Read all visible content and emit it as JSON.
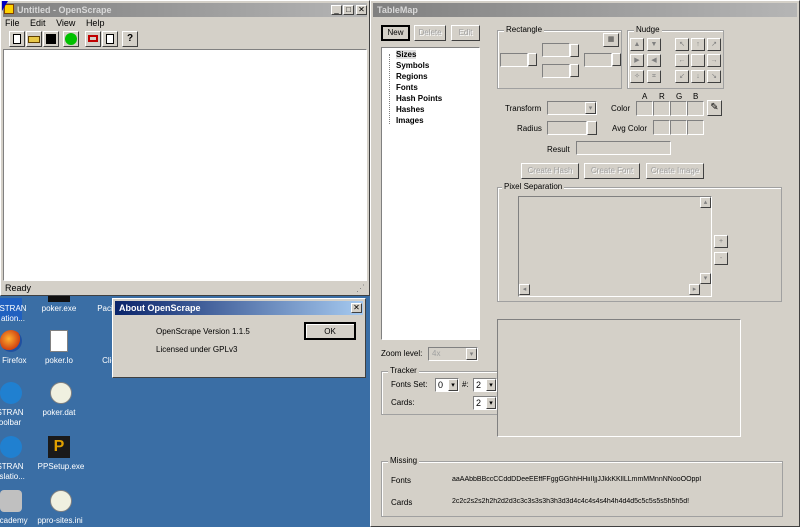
{
  "openscrape": {
    "title": "Untitled - OpenScrape",
    "menu": [
      "File",
      "Edit",
      "View",
      "Help"
    ],
    "status": "Ready"
  },
  "about": {
    "title": "About OpenScrape",
    "version": "OpenScrape Version 1.1.5",
    "license": "Licensed under GPLv3",
    "ok": "OK"
  },
  "tablemap": {
    "title": "TableMap",
    "buttons": {
      "new": "New",
      "delete": "Delete",
      "edit": "Edit"
    },
    "tree": [
      "Sizes",
      "Symbols",
      "Regions",
      "Fonts",
      "Hash Points",
      "Hashes",
      "Images"
    ],
    "rectangle_label": "Rectangle",
    "nudge_label": "Nudge",
    "transform_label": "Transform",
    "radius_label": "Radius",
    "color_label": "Color",
    "avg_color_label": "Avg Color",
    "result_label": "Result",
    "color_channels": [
      "A",
      "R",
      "G",
      "B"
    ],
    "create_hash": "Create Hash",
    "create_font": "Create Font",
    "create_image": "Create Image",
    "pixel_sep_label": "Pixel Separation",
    "zoom_label": "Zoom level:",
    "zoom_value": "4x",
    "tracker_label": "Tracker",
    "fonts_set_label": "Fonts Set:",
    "fonts_set_value": "0",
    "hash_label": "#:",
    "hash_value": "2",
    "cards_label": "Cards:",
    "cards_value": "2",
    "missing_label": "Missing",
    "missing_fonts_label": "Fonts",
    "missing_fonts_value": "aaAAbbBBccCCddDDeeEEffFFggGGhhHHiiIIjjJJkkKKllLLmmMMnnNNooOOppI",
    "missing_cards_label": "Cards",
    "missing_cards_value": "2c2c2s2s2h2h2d2d3c3c3s3s3h3h3d3d4c4c4s4s4h4h4d4d5c5c5s5s5h5h5d!"
  },
  "desktop": {
    "icons": [
      {
        "label": "STRAN ation..."
      },
      {
        "label": "poker.exe"
      },
      {
        "label": "Pacifi"
      },
      {
        "label": "a Firefox"
      },
      {
        "label": "poker.lo"
      },
      {
        "label": "Clie"
      },
      {
        "label": "STRAN oolbar"
      },
      {
        "label": "poker.dat"
      },
      {
        "label": "STRAN nslatio..."
      },
      {
        "label": "PPSetup.exe"
      },
      {
        "label": "Academy"
      },
      {
        "label": "ppro-sites.ini"
      }
    ]
  }
}
